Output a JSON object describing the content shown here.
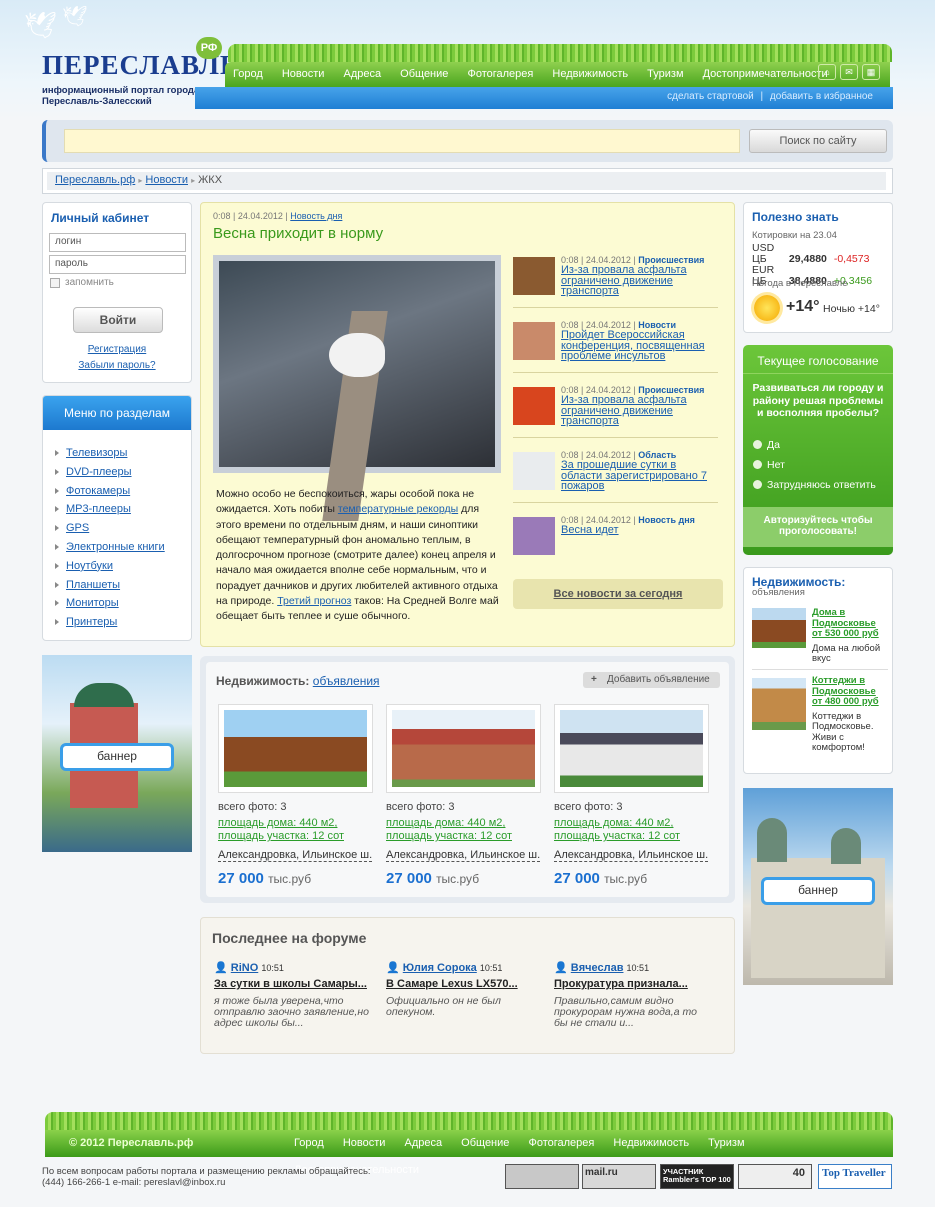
{
  "logo": {
    "title": "ПЕРЕСЛАВЛЬ",
    "badge": "РФ",
    "tagline": "информационный портал города Переславль-Залесский"
  },
  "nav": [
    "Город",
    "Новости",
    "Адреса",
    "Общение",
    "Фотогалерея",
    "Недвижимость",
    "Туризм",
    "Достопримечательности"
  ],
  "top_links": {
    "start": "сделать стартовой",
    "sep": "|",
    "fav": "добавить в избранное"
  },
  "search": {
    "value": "",
    "button": "Поиск по сайту"
  },
  "breadcrumb": {
    "home": "Переславль.рф",
    "news": "Новости",
    "current": "ЖКХ",
    "sep": "▸"
  },
  "cabinet": {
    "title": "Личный кабинет",
    "login": "логин",
    "password": "пароль",
    "remember": "запомнить",
    "submit": "Войти",
    "register": "Регистрация",
    "forgot": "Забыли пароль?"
  },
  "menu": {
    "title": "Меню по разделам",
    "items": [
      "Телевизоры",
      "DVD-плееры",
      "Фотокамеры",
      "MP3-плееры",
      "GPS",
      "Электронные книги",
      "Ноутбуки",
      "Планшеты",
      "Мониторы",
      "Принтеры"
    ]
  },
  "banner": "баннер",
  "main_news": {
    "meta": "0:08 | 24.04.2012 |",
    "cat": "Новость дня",
    "title": "Весна приходит в норму",
    "p1": "Можно особо не беспокоиться, жары особой пока не ожидается. Хоть побиты",
    "l1": "температурные рекорды",
    "p2": "для этого времени по отдельным дням, и наши синоптики обещают температурный фон аномально теплым, в долгосрочном прогнозе (смотрите далее) конец апреля и начало мая ожидается вполне себе нормальным, что и порадует дачников и других любителей активного отдыха на природе.",
    "l2": "Третий прогноз",
    "p3": "таков: На Средней Волге май обещает быть теплее и суше обычного."
  },
  "news": [
    {
      "meta": "0:08 | 24.04.2012 |",
      "cat": "Происшествия",
      "title": "Из-за провала асфальта ограничено движение транспорта"
    },
    {
      "meta": "0:08 | 24.04.2012 |",
      "cat": "Новости",
      "title": "Пройдет Всероссийская конференция, посвященная проблеме инсультов"
    },
    {
      "meta": "0:08 | 24.04.2012 |",
      "cat": "Происшествия",
      "title": "Из-за провала асфальта ограничено движение транспорта"
    },
    {
      "meta": "0:08 | 24.04.2012 |",
      "cat": "Область",
      "title": "За прошедшие сутки в области зарегистрировано 7 пожаров"
    },
    {
      "meta": "0:08 | 24.04.2012 |",
      "cat": "Новость дня",
      "title": "Весна идет"
    }
  ],
  "all_news": "Все новости за сегодня",
  "useful": {
    "title": "Полезно знать",
    "quotes": "Котировки на 23.04",
    "usd": "USD ЦБ",
    "usd_v": "29,4880",
    "usd_d": "-0,4573",
    "eur": "EUR ЦБ",
    "eur_v": "38,4880",
    "eur_d": "+0,3456",
    "weather_label": "Погода в Переславле",
    "temp": "+14°",
    "night": "Ночью +14°"
  },
  "vote": {
    "title": "Текущее голосование",
    "question": "Развиваться ли городу и району решая проблемы и восполняя пробелы?",
    "options": [
      "Да",
      "Нет",
      "Затрудняюсь ответить"
    ],
    "auth": "Авторизуйтесь чтобы проголосовать!"
  },
  "realty_side": {
    "title": "Недвижимость:",
    "sub": "объявления",
    "items": [
      {
        "title": "Дома в Подмосковье от 530 000 руб",
        "desc": "Дома на любой вкус"
      },
      {
        "title": "Коттеджи в Подмосковье от 480 000 руб",
        "desc": "Коттеджи в Подмосковье. Живи с комфортом!"
      }
    ]
  },
  "realty": {
    "title": "Недвижимость:",
    "link": "объявления",
    "add": "Добавить объявление",
    "cards": [
      {
        "photos": "всего фото: 3",
        "house": "площадь дома: 440 м2,",
        "plot": "площадь участка: 12 сот",
        "addr": "Александровка, Ильинское ш.",
        "price": "27 000",
        "unit": "тыс.руб"
      },
      {
        "photos": "всего фото: 3",
        "house": "площадь дома: 440 м2,",
        "plot": "площадь участка: 12 сот",
        "addr": "Александровка, Ильинское ш.",
        "price": "27 000",
        "unit": "тыс.руб"
      },
      {
        "photos": "всего фото: 3",
        "house": "площадь дома: 440 м2,",
        "plot": "площадь участка: 12 сот",
        "addr": "Александровка, Ильинское ш.",
        "price": "27 000",
        "unit": "тыс.руб"
      }
    ]
  },
  "forum": {
    "title": "Последнее на форуме",
    "posts": [
      {
        "user": "RiNO",
        "time": "10:51",
        "topic": "За сутки в школы Самары...",
        "text": "я тоже была уверена,что отправлю заочно заявление,но адрес школы бы..."
      },
      {
        "user": "Юлия Сорока",
        "time": "10:51",
        "topic": "В Самаре Lexus LX570...",
        "text": "Официально он не был опекуном."
      },
      {
        "user": "Вячеслав",
        "time": "10:51",
        "topic": "Прокуратура признала...",
        "text": "Правильно,самим видно прокурорам нужна вода,а то бы не стали и..."
      }
    ]
  },
  "footer": {
    "copy": "© 2012 Переславль.рф",
    "contact1": "По всем вопросам работы портала и размещению рекламы обращайтесь:",
    "contact2": "(444) 166-266-1   e-mail: pereslavl@inbox.ru",
    "counters": [
      "mail.ru",
      "УЧАСТНИК Rambler's TOP 100",
      "40",
      "Top Traveller"
    ]
  },
  "colors": {
    "accent_blue": "#1a5fb0",
    "green": "#4aa51e",
    "news_bg": "#fcfbd3"
  }
}
